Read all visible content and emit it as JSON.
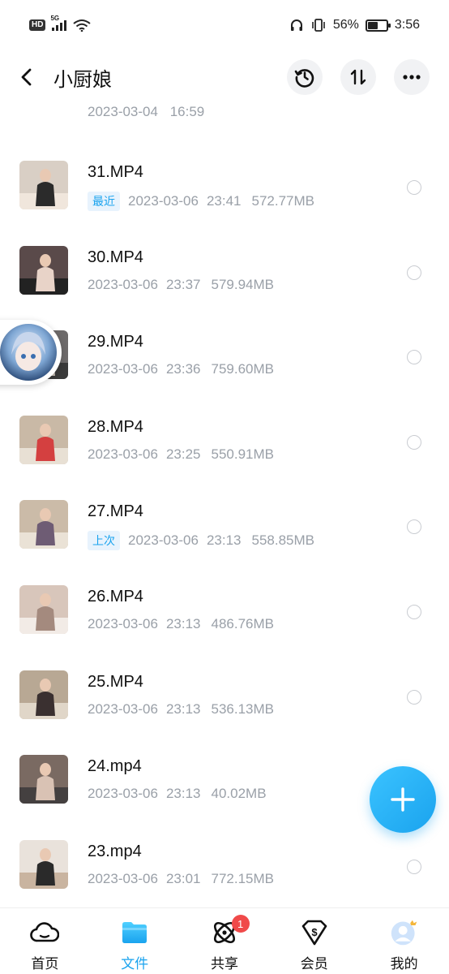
{
  "status": {
    "network": "5G",
    "battery": "56%",
    "battery_level": 0.56,
    "time": "3:56",
    "hd": "HD"
  },
  "header": {
    "title": "小厨娘"
  },
  "partial_row": {
    "date": "2023-03-04",
    "time": "16:59"
  },
  "files": [
    {
      "name": "31.MP4",
      "tag": "最近",
      "date": "2023-03-06",
      "time": "23:41",
      "size": "572.77MB"
    },
    {
      "name": "30.MP4",
      "tag": "",
      "date": "2023-03-06",
      "time": "23:37",
      "size": "579.94MB"
    },
    {
      "name": "29.MP4",
      "tag": "",
      "date": "2023-03-06",
      "time": "23:36",
      "size": "759.60MB"
    },
    {
      "name": "28.MP4",
      "tag": "",
      "date": "2023-03-06",
      "time": "23:25",
      "size": "550.91MB"
    },
    {
      "name": "27.MP4",
      "tag": "上次",
      "date": "2023-03-06",
      "time": "23:13",
      "size": "558.85MB"
    },
    {
      "name": "26.MP4",
      "tag": "",
      "date": "2023-03-06",
      "time": "23:13",
      "size": "486.76MB"
    },
    {
      "name": "25.MP4",
      "tag": "",
      "date": "2023-03-06",
      "time": "23:13",
      "size": "536.13MB"
    },
    {
      "name": "24.mp4",
      "tag": "",
      "date": "2023-03-06",
      "time": "23:13",
      "size": "40.02MB"
    },
    {
      "name": "23.mp4",
      "tag": "",
      "date": "2023-03-06",
      "time": "23:01",
      "size": "772.15MB"
    }
  ],
  "nav": [
    {
      "label": "首页",
      "icon": "cloud-icon"
    },
    {
      "label": "文件",
      "icon": "folder-icon"
    },
    {
      "label": "共享",
      "icon": "share-atom-icon",
      "badge": "1"
    },
    {
      "label": "会员",
      "icon": "vip-diamond-icon"
    },
    {
      "label": "我的",
      "icon": "profile-avatar-icon"
    }
  ],
  "colors": {
    "accent": "#1aa3ee",
    "meta": "#9aa0a8",
    "badge": "#f04a4a"
  }
}
